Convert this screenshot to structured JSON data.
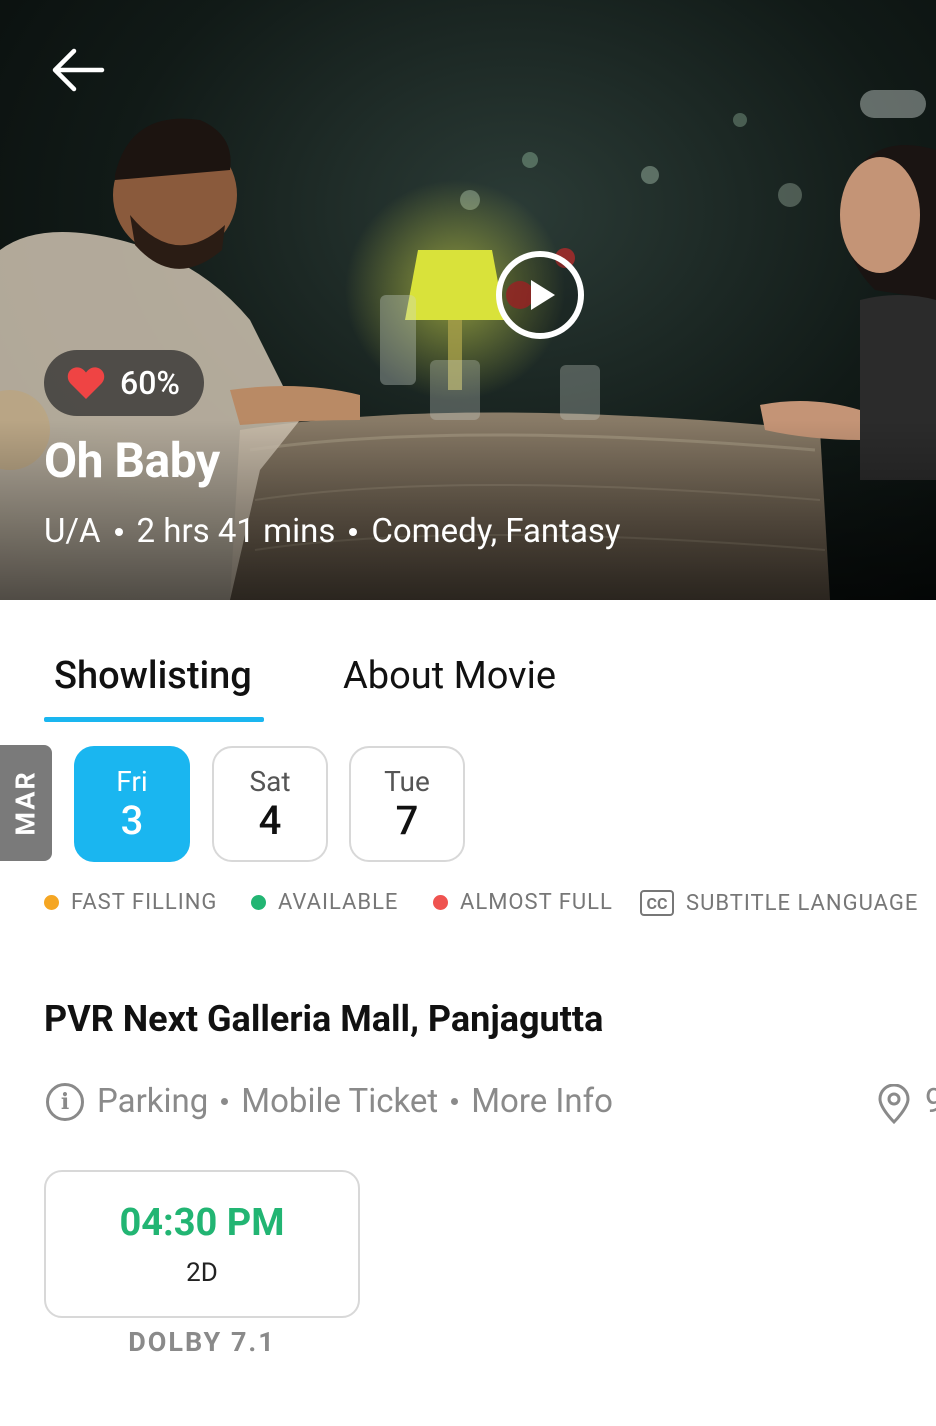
{
  "hero": {
    "rating": "60%",
    "title": "Oh Baby",
    "certification": "U/A",
    "duration": "2 hrs 41 mins",
    "genres": "Comedy, Fantasy"
  },
  "tabs": [
    {
      "label": "Showlisting",
      "active": true
    },
    {
      "label": "About Movie",
      "active": false
    }
  ],
  "month": "MAR",
  "dates": [
    {
      "day": "Fri",
      "num": "3",
      "selected": true
    },
    {
      "day": "Sat",
      "num": "4",
      "selected": false
    },
    {
      "day": "Tue",
      "num": "7",
      "selected": false
    }
  ],
  "legend": {
    "fast_filling": "FAST FILLING",
    "available": "AVAILABLE",
    "almost_full": "ALMOST FULL",
    "subtitle": "SUBTITLE LANGUAGE",
    "cc_icon_text": "CC"
  },
  "colors": {
    "accent": "#1ab6f0",
    "fast_filling": "#f5a623",
    "available": "#22b573",
    "almost_full": "#ef5350"
  },
  "cinema": {
    "name": "PVR Next Galleria Mall, Panjagutta",
    "info_items": [
      "Parking",
      "Mobile Ticket",
      "More Info"
    ],
    "distance_partial": "9"
  },
  "showtimes": [
    {
      "time": "04:30 PM",
      "format": "2D",
      "sound": "DOLBY 7.1"
    }
  ]
}
